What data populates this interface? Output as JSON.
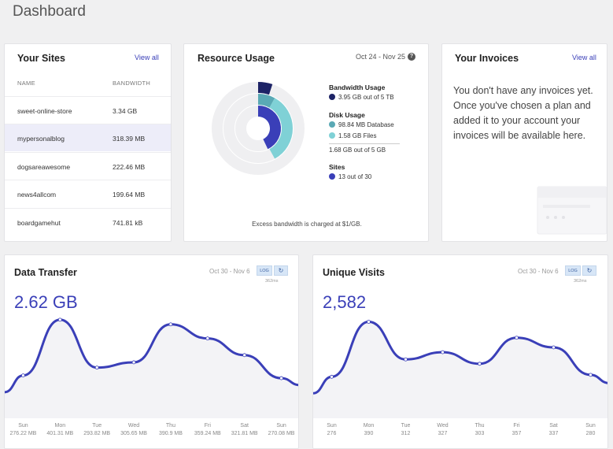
{
  "page": {
    "title": "Dashboard"
  },
  "sites": {
    "title": "Your Sites",
    "view_all": "View all",
    "columns": [
      "NAME",
      "BANDWIDTH"
    ],
    "rows": [
      {
        "name": "sweet-online-store",
        "bandwidth": "3.34 GB"
      },
      {
        "name": "mypersonalblog",
        "bandwidth": "318.39 MB"
      },
      {
        "name": "dogsareawesome",
        "bandwidth": "222.46 MB"
      },
      {
        "name": "news4allcom",
        "bandwidth": "199.64 MB"
      },
      {
        "name": "boardgamehut",
        "bandwidth": "741.81 kB"
      }
    ]
  },
  "resource": {
    "title": "Resource Usage",
    "date_range": "Oct 24 - Nov 25",
    "help_icon": "?",
    "bandwidth_heading": "Bandwidth Usage",
    "bandwidth_value": "3.95 GB out of 5 TB",
    "disk_heading": "Disk Usage",
    "disk_database": "98.84 MB Database",
    "disk_files": "1.58 GB Files",
    "disk_total": "1.68 GB out of 5 GB",
    "sites_heading": "Sites",
    "sites_value": "13 out of 30",
    "footnote": "Excess bandwidth is charged at $1/GB.",
    "usage_fractions": {
      "bandwidth": 0.05,
      "disk_database": 0.08,
      "disk_files": 0.34,
      "sites": 0.43
    },
    "colors": {
      "bandwidth": "#1d2366",
      "database": "#5aa9b5",
      "files": "#7fd1d6",
      "sites": "#3a3fb8",
      "track": "#efeff1"
    }
  },
  "invoices": {
    "title": "Your Invoices",
    "view_all": "View all",
    "message": "You don't have any invoices yet. Once you've chosen a plan and added it to your account your invoices will be available here."
  },
  "transfer": {
    "title": "Data Transfer",
    "date_range": "Oct 30 - Nov 6",
    "log_label": "LOG",
    "ms_label": "362ms",
    "total": "2.62 GB",
    "days": [
      {
        "day": "Sun",
        "value": "276.22 MB"
      },
      {
        "day": "Mon",
        "value": "401.31 MB"
      },
      {
        "day": "Tue",
        "value": "293.82 MB"
      },
      {
        "day": "Wed",
        "value": "305.65 MB"
      },
      {
        "day": "Thu",
        "value": "390.9 MB"
      },
      {
        "day": "Fri",
        "value": "359.24 MB"
      },
      {
        "day": "Sat",
        "value": "321.81 MB"
      },
      {
        "day": "Sun",
        "value": "270.08 MB"
      }
    ],
    "chart_data": {
      "type": "area",
      "categories": [
        "Sun",
        "Mon",
        "Tue",
        "Wed",
        "Thu",
        "Fri",
        "Sat",
        "Sun"
      ],
      "values": [
        276.22,
        401.31,
        293.82,
        305.65,
        390.9,
        359.24,
        321.81,
        270.08
      ],
      "ylim": [
        180,
        440
      ]
    }
  },
  "visits": {
    "title": "Unique Visits",
    "date_range": "Oct 30 - Nov 6",
    "log_label": "LOG",
    "ms_label": "362ms",
    "total": "2,582",
    "days": [
      {
        "day": "Sun",
        "value": "276"
      },
      {
        "day": "Mon",
        "value": "390"
      },
      {
        "day": "Tue",
        "value": "312"
      },
      {
        "day": "Wed",
        "value": "327"
      },
      {
        "day": "Thu",
        "value": "303"
      },
      {
        "day": "Fri",
        "value": "357"
      },
      {
        "day": "Sat",
        "value": "337"
      },
      {
        "day": "Sun",
        "value": "280"
      }
    ],
    "chart_data": {
      "type": "area",
      "categories": [
        "Sun",
        "Mon",
        "Tue",
        "Wed",
        "Thu",
        "Fri",
        "Sat",
        "Sun"
      ],
      "values": [
        276,
        390,
        312,
        327,
        303,
        357,
        337,
        280
      ],
      "ylim": [
        190,
        430
      ]
    }
  },
  "colors": {
    "accent": "#3a3fb8",
    "line": "#3a3fb8",
    "area": "#f3f3f6"
  }
}
